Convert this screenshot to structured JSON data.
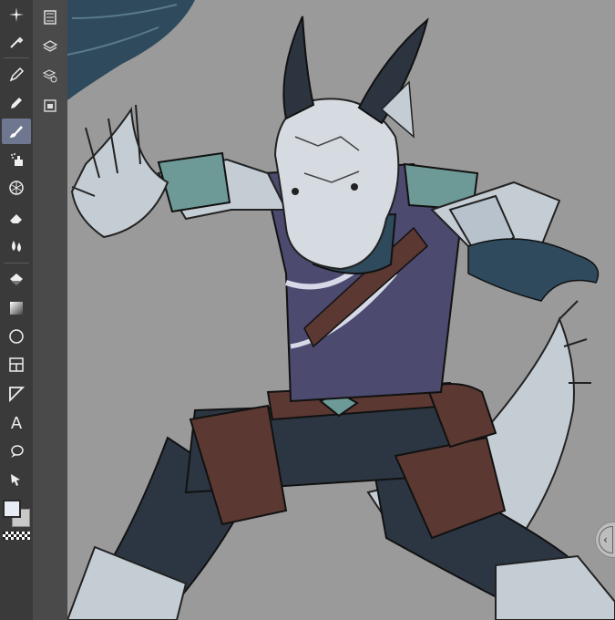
{
  "toolbar": {
    "tools": [
      {
        "name": "sparkle-icon",
        "active": false
      },
      {
        "name": "eyedropper-icon",
        "active": false
      },
      {
        "name": "pen-icon",
        "active": false
      },
      {
        "name": "pencil-icon",
        "active": false
      },
      {
        "name": "brush-icon",
        "active": true
      },
      {
        "name": "airbrush-icon",
        "active": false
      },
      {
        "name": "decoration-icon",
        "active": false
      },
      {
        "name": "eraser-icon",
        "active": false
      },
      {
        "name": "blend-icon",
        "active": false
      },
      {
        "name": "fill-icon",
        "active": false
      },
      {
        "name": "gradient-icon",
        "active": false
      },
      {
        "name": "shape-icon",
        "active": false
      },
      {
        "name": "frame-icon",
        "active": false
      },
      {
        "name": "ruler-icon",
        "active": false
      },
      {
        "name": "text-icon",
        "active": false
      },
      {
        "name": "balloon-icon",
        "active": false
      },
      {
        "name": "correct-line-icon",
        "active": false
      }
    ],
    "text_tool_glyph": "A",
    "main_color": "#e8ecf4",
    "sub_color": "#c8c8c8"
  },
  "subtoolbar": {
    "items": [
      "filmstrip-icon",
      "layers-icon",
      "layer-properties-icon",
      "material-icon"
    ]
  },
  "canvas": {
    "background": "#9a9a9a",
    "collapse_glyph": "‹"
  }
}
